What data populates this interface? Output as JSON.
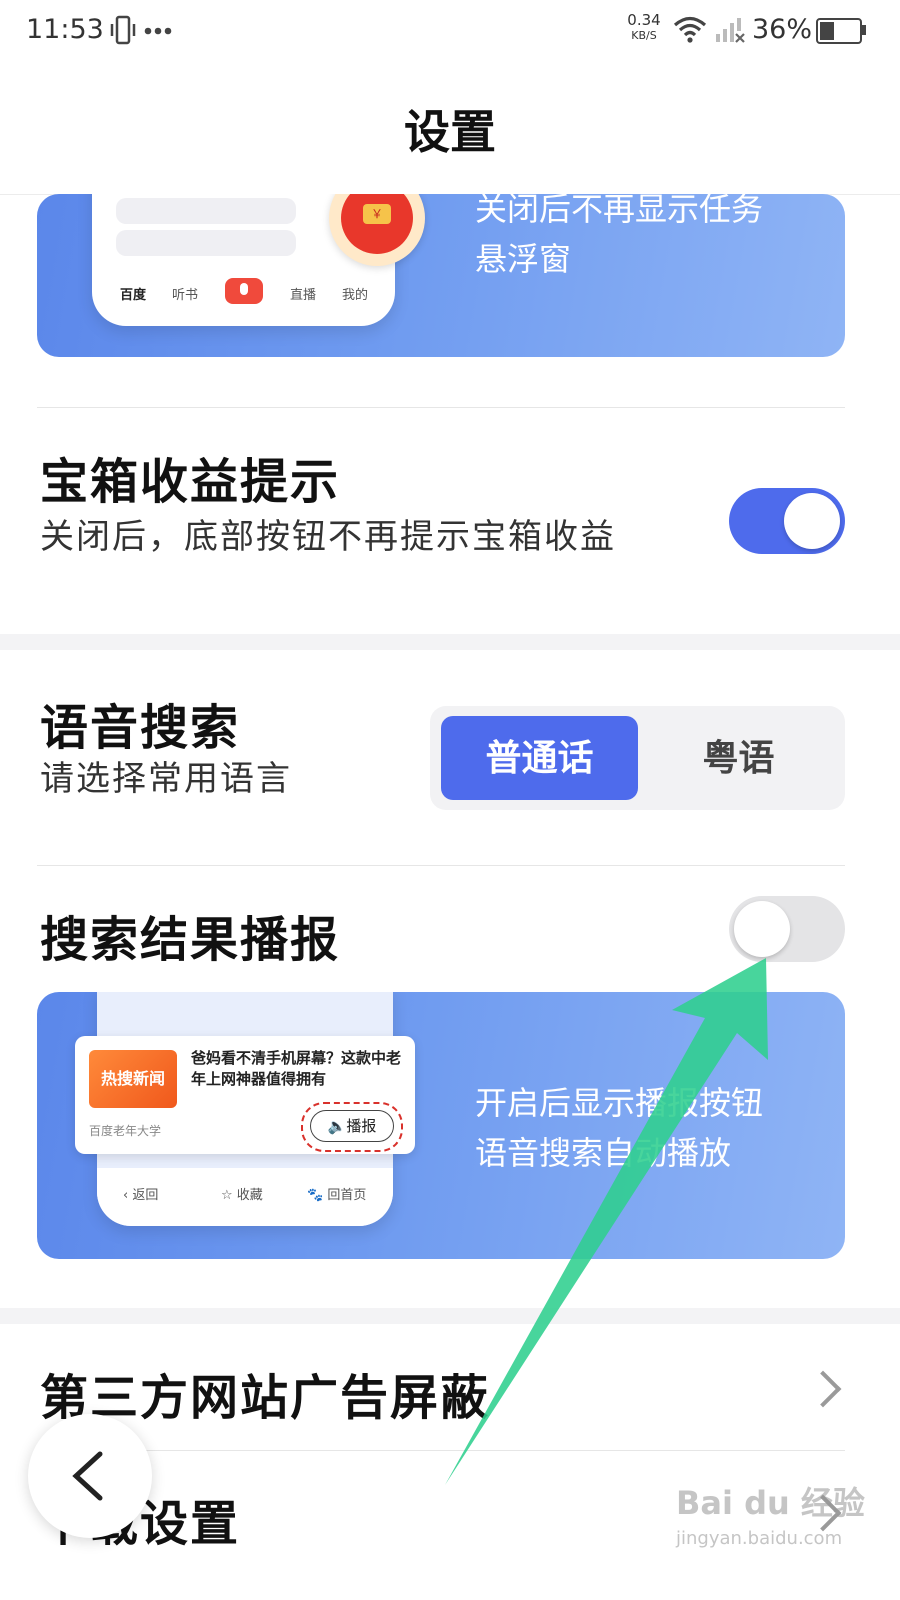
{
  "status_bar": {
    "time": "11:53",
    "network_speed": "0.34",
    "network_unit": "KB/S",
    "battery": "36%",
    "icons": [
      "vibrate-icon",
      "more-icon",
      "wifi-icon",
      "signal-icon",
      "battery-icon"
    ]
  },
  "header": {
    "title": "设置"
  },
  "float_banner": {
    "text_line1": "关闭后不再显示任务",
    "text_line2": "悬浮窗",
    "tabs": [
      "百度",
      "听书",
      "直播",
      "我的"
    ],
    "coin": "￥"
  },
  "treasure": {
    "title": "宝箱收益提示",
    "desc": "关闭后，底部按钮不再提示宝箱收益",
    "toggle_on": true
  },
  "voice_search": {
    "title": "语音搜索",
    "desc": "请选择常用语言",
    "options": [
      "普通话",
      "粤语"
    ],
    "selected": "普通话"
  },
  "broadcast": {
    "title": "搜索结果播报",
    "toggle_on": false,
    "banner_line1": "开启后显示播报按钮",
    "banner_line2": "语音搜索自动播放",
    "news_tag": "热搜新闻",
    "news_title": "爸妈看不清手机屏幕？这款中老年上网神器值得拥有",
    "news_source": "百度老年大学",
    "play_label": "播报",
    "nav": [
      "返回",
      "收藏",
      "回首页"
    ]
  },
  "menu": {
    "item1": "第三方网站广告屏蔽",
    "item2": "下载设置"
  },
  "watermark": {
    "logo": "Bai du 经验",
    "url": "jingyan.baidu.com"
  },
  "colors": {
    "accent": "#4e6bec",
    "banner": "#6f9bf0",
    "arrow": "#2fcf8e",
    "tag": "#f0581c"
  }
}
